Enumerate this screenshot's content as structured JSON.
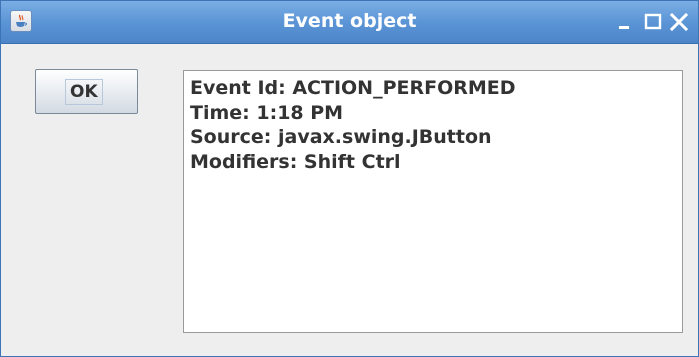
{
  "window": {
    "title": "Event object",
    "app_icon": "java-cup-icon",
    "controls": [
      "minimize-icon",
      "maximize-icon",
      "close-icon"
    ]
  },
  "ok_button": {
    "label": "OK"
  },
  "event_text": {
    "lines": [
      "Event Id: ACTION_PERFORMED",
      "Time: 1:18 PM",
      "Source: javax.swing.JButton",
      "Modifiers: Shift Ctrl"
    ]
  },
  "colors": {
    "titlebar": "#5c95d6",
    "title_text": "#ffffff",
    "window_bg": "#eeeeee",
    "text": "#333333"
  }
}
